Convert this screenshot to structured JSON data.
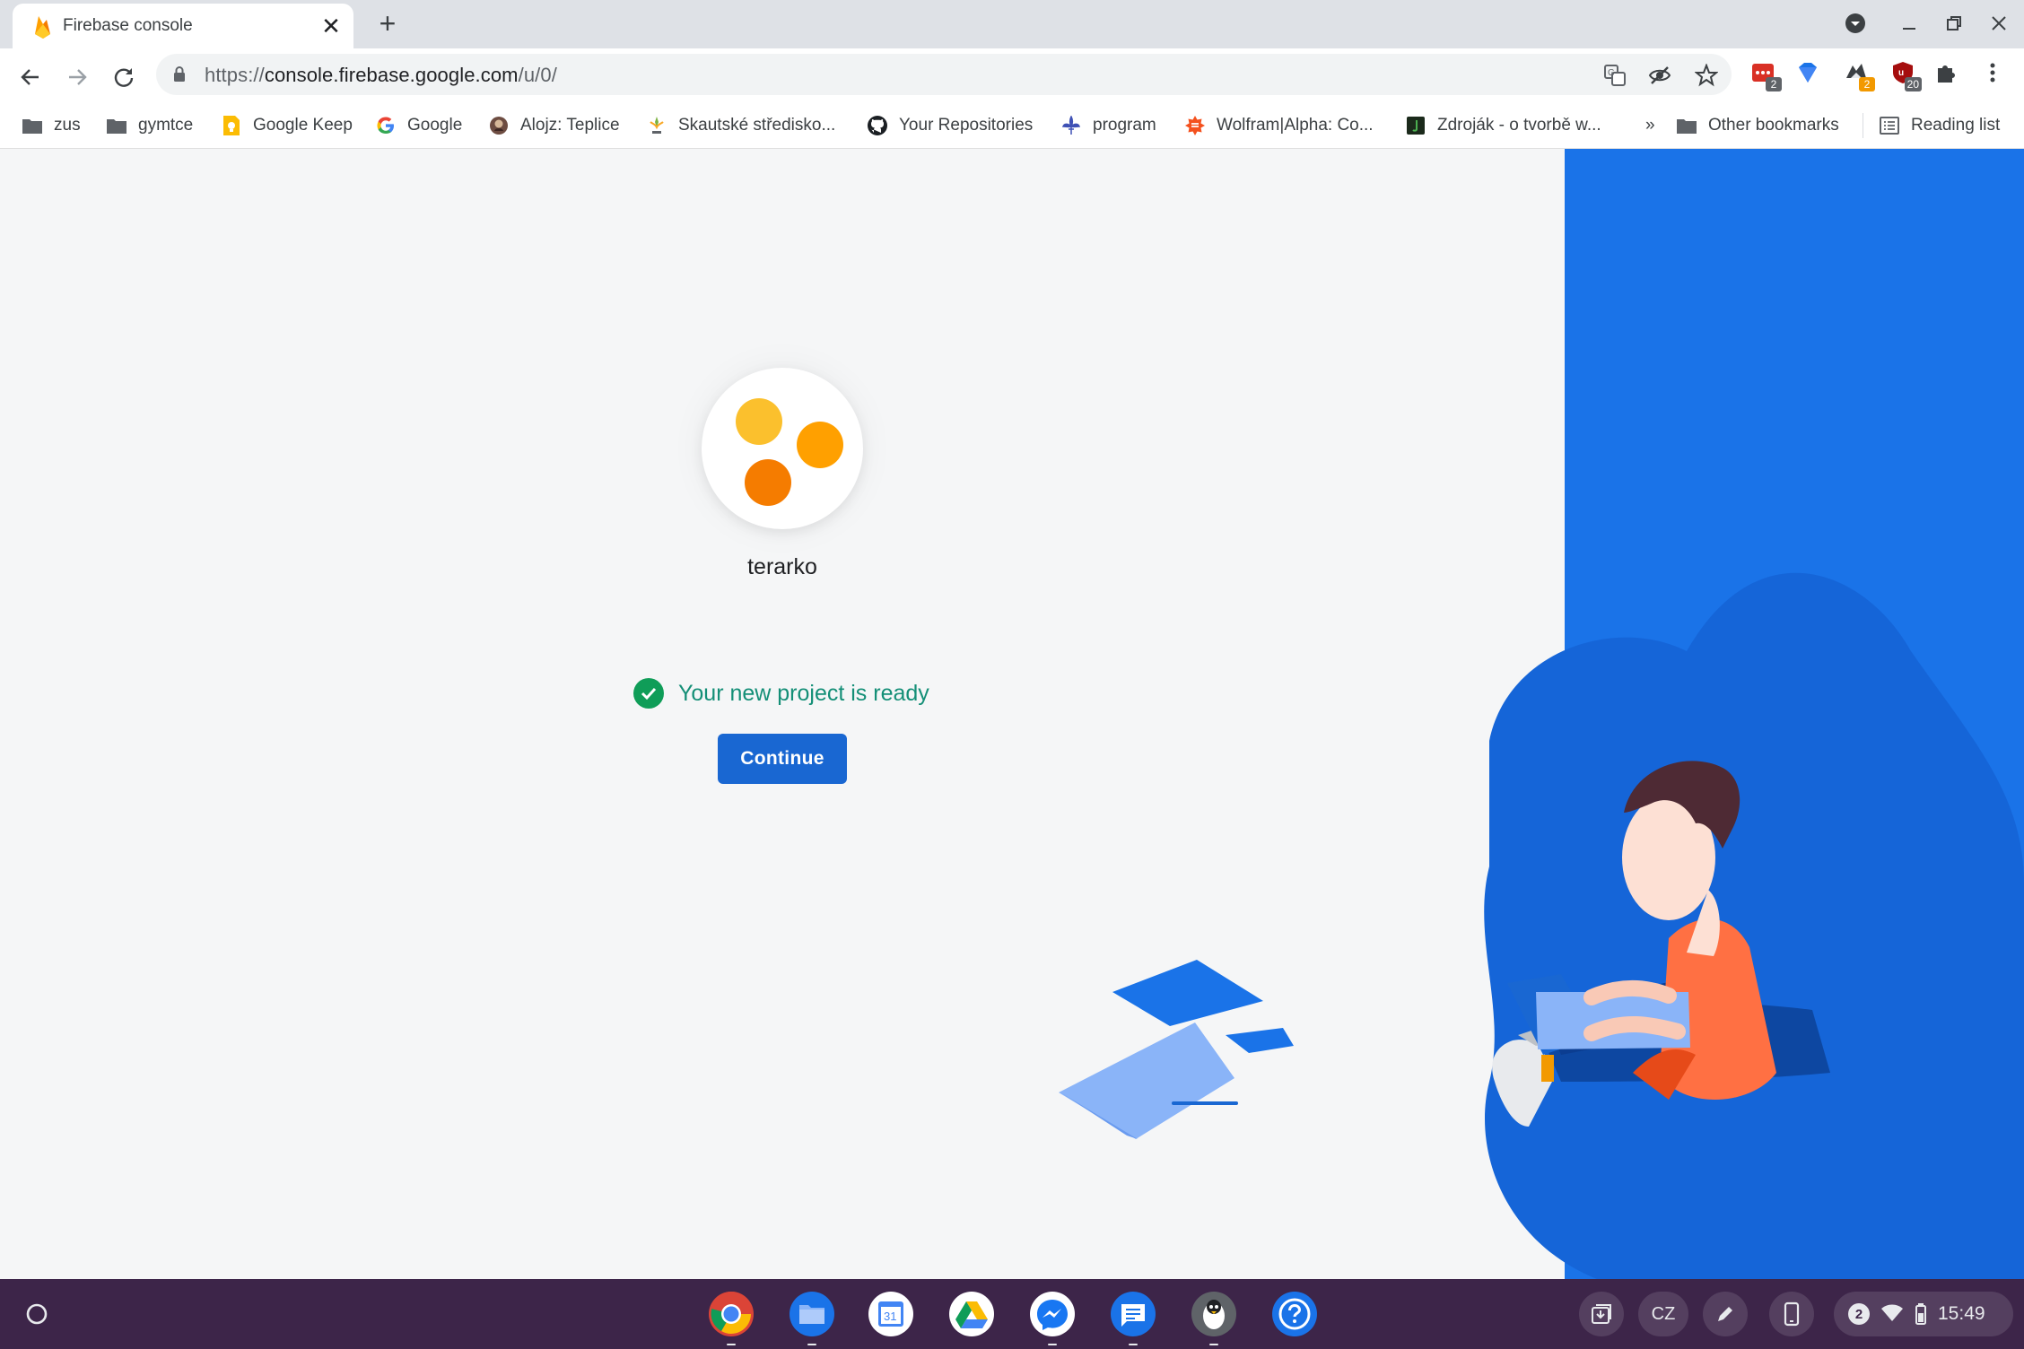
{
  "browser": {
    "tab": {
      "title": "Firebase console"
    },
    "omnibox": {
      "url_scheme": "https://",
      "url_host": "console.firebase.google.com",
      "url_path": "/u/0/"
    },
    "extensions": [
      {
        "name": "todo-extension-icon",
        "badge": "2",
        "badge_color": "#5f6368"
      },
      {
        "name": "diamond-extension-icon",
        "badge": ""
      },
      {
        "name": "wolf-extension-icon",
        "badge": "2",
        "badge_color": "#f29900"
      },
      {
        "name": "shield-extension-icon",
        "badge": "20",
        "badge_color": "#5f6368"
      }
    ]
  },
  "bookmarks": {
    "items": [
      {
        "label": "zus",
        "icon": "folder-icon"
      },
      {
        "label": "gymtce",
        "icon": "folder-icon"
      },
      {
        "label": "Google Keep",
        "icon": "keep-icon"
      },
      {
        "label": "Google",
        "icon": "google-icon"
      },
      {
        "label": "Alojz: Teplice",
        "icon": "avatar-icon"
      },
      {
        "label": "Skautské středisko...",
        "icon": "scout-icon"
      },
      {
        "label": "Your Repositories",
        "icon": "github-icon"
      },
      {
        "label": "program",
        "icon": "fleur-icon"
      },
      {
        "label": "Wolfram|Alpha: Co...",
        "icon": "wolfram-icon"
      },
      {
        "label": "Zdroják - o tvorbě w...",
        "icon": "zdrojak-icon"
      }
    ],
    "overflow": "»",
    "other": "Other bookmarks",
    "reading_list": "Reading list"
  },
  "page": {
    "project_name": "terarko",
    "status_message": "Your new project is ready",
    "continue_label": "Continue"
  },
  "colors": {
    "accent": "#1967d2",
    "success": "#148f77",
    "panel": "#1a73e8",
    "shelf": "#3d2549"
  },
  "shelf": {
    "apps": [
      "chrome-icon",
      "files-icon",
      "calendar-icon",
      "drive-icon",
      "messenger-icon",
      "messages-icon",
      "linux-icon",
      "help-icon"
    ],
    "calendar_day": "31",
    "ime": "CZ",
    "notifications": "2",
    "time": "15:49"
  }
}
